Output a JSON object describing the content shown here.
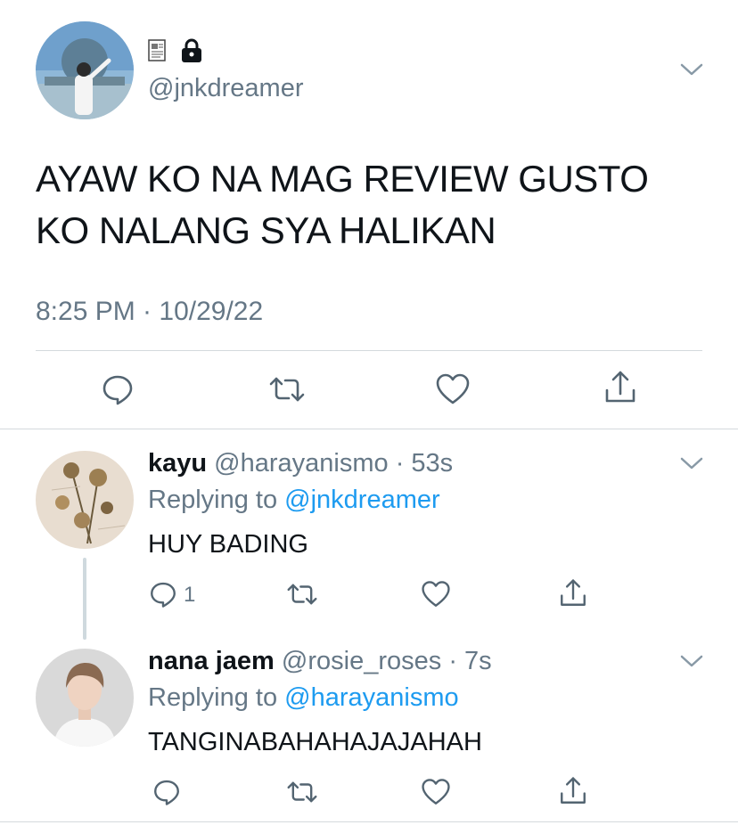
{
  "main_tweet": {
    "name_badges": [
      "📰",
      "🔒"
    ],
    "handle": "@jnkdreamer",
    "text_line1": "AYAW KO NA MAG REVIEW GUSTO",
    "text_line2": "KO NALANG SYA HALIKAN",
    "timestamp": "8:25 PM · 10/29/22",
    "actions": [
      "reply-icon",
      "retweet-icon",
      "like-icon",
      "share-icon"
    ]
  },
  "replies": [
    {
      "name": "kayu",
      "handle": "@harayanismo",
      "time": "· 53s",
      "replying_label": "Replying to",
      "replying_to": "@jnkdreamer",
      "text": "HUY BADING",
      "reply_count": "1"
    },
    {
      "name": "nana jaem",
      "handle": "@rosie_roses",
      "time": "· 7s",
      "replying_label": "Replying to",
      "replying_to": "@harayanismo",
      "text": "TANGINABAHAHAJAJAHAH",
      "reply_count": ""
    }
  ],
  "colors": {
    "text": "#0f1419",
    "muted": "#657786",
    "link": "#1d9bf0",
    "divider": "#d4d9dd"
  }
}
